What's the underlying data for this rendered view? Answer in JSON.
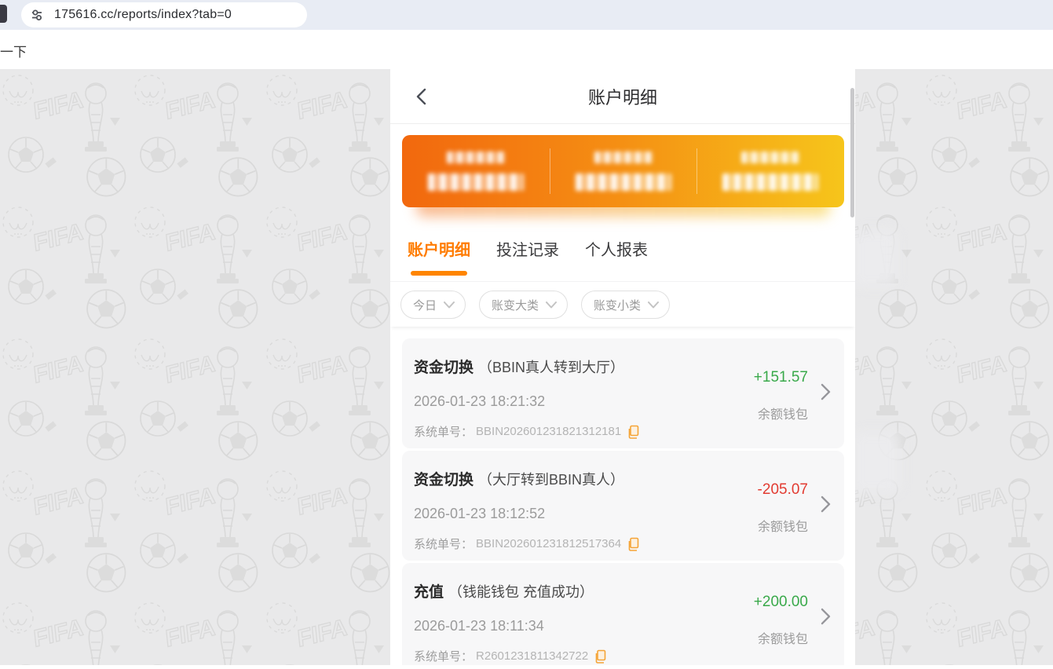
{
  "browser": {
    "url": "175616.cc/reports/index?tab=0",
    "page_text_fragment": "一下"
  },
  "panel": {
    "title": "账户明细",
    "summary_card": {
      "censored": true,
      "column_count": 3
    },
    "tabs": [
      {
        "label": "账户明细",
        "active": true
      },
      {
        "label": "投注记录",
        "active": false
      },
      {
        "label": "个人报表",
        "active": false
      }
    ],
    "filters": [
      {
        "label": "今日"
      },
      {
        "label": "账变大类"
      },
      {
        "label": "账变小类"
      }
    ],
    "order_label": "系统单号："
  },
  "transactions": [
    {
      "type": "资金切换",
      "detail": "（BBIN真人转到大厅）",
      "time": "2026-01-23 18:21:32",
      "order_no": "BBIN202601231821312181",
      "amount": "+151.57",
      "amount_class": "amount positive",
      "wallet": "余额钱包"
    },
    {
      "type": "资金切换",
      "detail": "（大厅转到BBIN真人）",
      "time": "2026-01-23 18:12:52",
      "order_no": "BBIN202601231812517364",
      "amount": "-205.07",
      "amount_class": "amount negative",
      "wallet": "余额钱包"
    },
    {
      "type": "充值",
      "detail": "（钱能钱包 充值成功）",
      "time": "2026-01-23 18:11:34",
      "order_no": "R2601231811342722",
      "amount": "+200.00",
      "amount_class": "amount positive",
      "wallet": "余额钱包"
    }
  ],
  "colors": {
    "accent_orange": "#ff7c00",
    "positive_green": "#39a94a",
    "negative_red": "#e23b31",
    "card_gradient_start": "#f2680e",
    "card_gradient_end": "#f6c51b",
    "toolbar": "#e8ecf4"
  }
}
